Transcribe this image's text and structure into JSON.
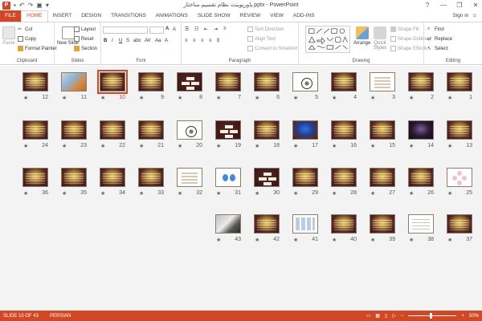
{
  "window": {
    "title": "پاورپوینت نظام تقسیم ساختار.pptx - PowerPoint",
    "app_logo": "P",
    "controls": [
      "?",
      "—",
      "❐",
      "✕"
    ]
  },
  "tabs": [
    "FILE",
    "HOME",
    "INSERT",
    "DESIGN",
    "TRANSITIONS",
    "ANIMATIONS",
    "SLIDE SHOW",
    "REVIEW",
    "VIEW",
    "ADD-INS"
  ],
  "active_tab": "HOME",
  "signin": "Sign in",
  "ribbon": {
    "clipboard": {
      "label": "Clipboard",
      "paste": "Paste",
      "cut": "Cut",
      "copy": "Copy",
      "format_painter": "Format Painter"
    },
    "slides": {
      "label": "Slides",
      "new_slide": "New Slide",
      "layout": "Layout",
      "reset": "Reset",
      "section": "Section"
    },
    "font": {
      "label": "Font",
      "bold": "B",
      "italic": "I",
      "underline": "U",
      "strike": "S",
      "shadow": "abc",
      "spacing": "AV",
      "case": "Aa",
      "color": "A"
    },
    "paragraph": {
      "label": "Paragraph",
      "text_direction": "Text Direction",
      "align_text": "Align Text",
      "smartart": "Convert to SmartArt"
    },
    "drawing": {
      "label": "Drawing",
      "arrange": "Arrange",
      "quick_styles": "Quick Styles",
      "shape_fill": "Shape Fill",
      "shape_outline": "Shape Outline",
      "shape_effects": "Shape Effects"
    },
    "editing": {
      "label": "Editing",
      "find": "Find",
      "replace": "Replace",
      "select": "Select"
    }
  },
  "slides": [
    {
      "n": "1",
      "type": "brown"
    },
    {
      "n": "2",
      "type": "brown"
    },
    {
      "n": "3",
      "type": "white"
    },
    {
      "n": "4",
      "type": "brown"
    },
    {
      "n": "5",
      "type": "circle"
    },
    {
      "n": "6",
      "type": "brown"
    },
    {
      "n": "7",
      "type": "brown"
    },
    {
      "n": "8",
      "type": "boxes"
    },
    {
      "n": "9",
      "type": "brown"
    },
    {
      "n": "10",
      "type": "brown"
    },
    {
      "n": "11",
      "type": "photo"
    },
    {
      "n": "12",
      "type": "brown"
    },
    {
      "n": "13",
      "type": "brown"
    },
    {
      "n": "14",
      "type": "dark"
    },
    {
      "n": "15",
      "type": "brown"
    },
    {
      "n": "16",
      "type": "brown"
    },
    {
      "n": "17",
      "type": "blue"
    },
    {
      "n": "18",
      "type": "brown"
    },
    {
      "n": "19",
      "type": "boxes"
    },
    {
      "n": "20",
      "type": "circle"
    },
    {
      "n": "21",
      "type": "brown"
    },
    {
      "n": "22",
      "type": "brown"
    },
    {
      "n": "23",
      "type": "brown"
    },
    {
      "n": "24",
      "type": "brown"
    },
    {
      "n": "25",
      "type": "pinkcircles"
    },
    {
      "n": "26",
      "type": "brown"
    },
    {
      "n": "27",
      "type": "brown"
    },
    {
      "n": "28",
      "type": "brown"
    },
    {
      "n": "29",
      "type": "brown"
    },
    {
      "n": "30",
      "type": "boxes"
    },
    {
      "n": "31",
      "type": "bluedots"
    },
    {
      "n": "32",
      "type": "white"
    },
    {
      "n": "33",
      "type": "brown"
    },
    {
      "n": "34",
      "type": "brown"
    },
    {
      "n": "35",
      "type": "brown"
    },
    {
      "n": "36",
      "type": "brown"
    },
    {
      "n": "37",
      "type": "brown"
    },
    {
      "n": "38",
      "type": "table"
    },
    {
      "n": "39",
      "type": "brown"
    },
    {
      "n": "40",
      "type": "brown"
    },
    {
      "n": "41",
      "type": "grid"
    },
    {
      "n": "42",
      "type": "brown"
    },
    {
      "n": "43",
      "type": "photo2"
    }
  ],
  "selected_slide": "10",
  "status": {
    "slide_info": "SLIDE 10 OF 43",
    "language": "PERSIAN",
    "zoom": "50%"
  },
  "colors": {
    "accent": "#d24726",
    "sorter_bg": "#f3f3f3"
  }
}
